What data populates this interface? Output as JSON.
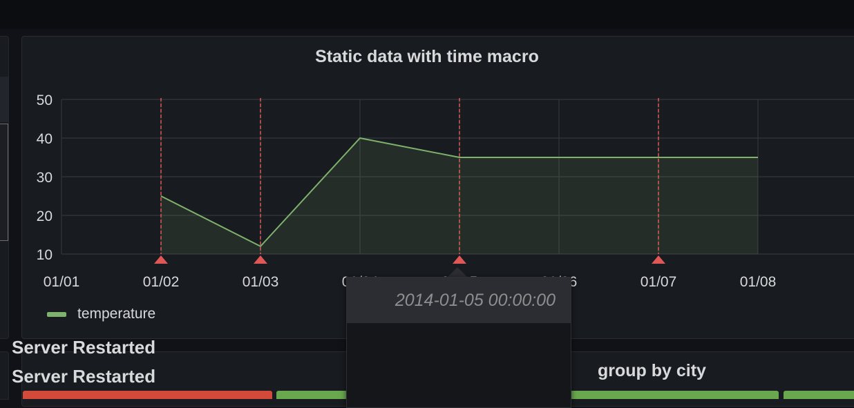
{
  "panel": {
    "title": "Static data with time macro"
  },
  "chart_data": {
    "type": "area",
    "x": [
      "01/02",
      "01/03",
      "01/04",
      "01/05",
      "01/06",
      "01/07",
      "01/08"
    ],
    "x_ticks": [
      "01/01",
      "01/02",
      "01/03",
      "01/04",
      "01/05",
      "01/06",
      "01/07",
      "01/08",
      "01"
    ],
    "y_ticks": [
      "50",
      "40",
      "30",
      "20",
      "10"
    ],
    "ylim": [
      10,
      50
    ],
    "series": [
      {
        "name": "temperature",
        "color": "#7eb26d",
        "values": [
          25,
          12,
          40,
          35,
          35,
          35,
          35
        ]
      }
    ],
    "annotations": [
      "01/02",
      "01/03",
      "01/05",
      "01/07"
    ],
    "annotation_color": "#e05757",
    "grid": true,
    "legend": "bottom-left"
  },
  "legend": {
    "items": [
      {
        "label": "temperature",
        "color": "#7eb26d"
      }
    ]
  },
  "tooltip": {
    "time": "2014-01-05 00:00:00",
    "lines": [
      "Server Restarted",
      "Server Restarted"
    ]
  },
  "panel2": {
    "title": "group by city"
  },
  "colors": {
    "background": "#111217",
    "panel": "#181b1f",
    "red": "#d44a3a",
    "green": "#6aa84f"
  }
}
